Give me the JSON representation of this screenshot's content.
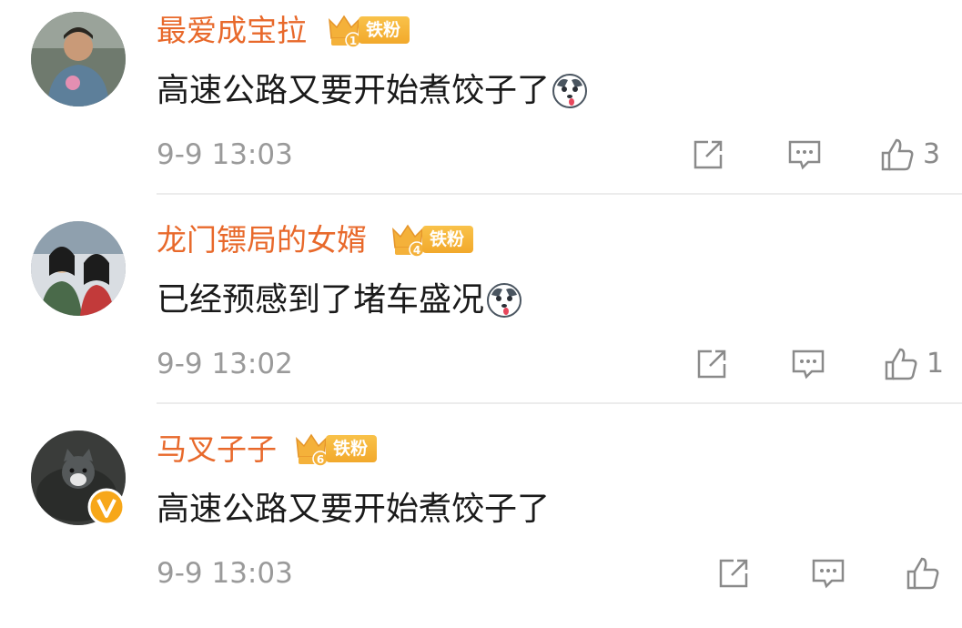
{
  "comments": [
    {
      "username": "最爱成宝拉",
      "fan_level": "1",
      "fan_label": "铁粉",
      "text": "高速公路又要开始煮饺子了",
      "has_emoji": true,
      "emoji_icon": "husky-dog-emoji-icon",
      "timestamp": "9-9 13:03",
      "like_count": "3"
    },
    {
      "username": "龙门镖局的女婿",
      "fan_level": "4",
      "fan_label": "铁粉",
      "text": "已经预感到了堵车盛况",
      "has_emoji": true,
      "emoji_icon": "husky-dog-emoji-icon",
      "timestamp": "9-9 13:02",
      "like_count": "1"
    },
    {
      "username": "马叉子子",
      "fan_level": "6",
      "fan_label": "铁粉",
      "text": "高速公路又要开始煮饺子了",
      "has_emoji": false,
      "verified": true,
      "timestamp": "9-9 13:03",
      "like_count": ""
    }
  ],
  "icons": {
    "share": "share-icon",
    "reply": "comment-icon",
    "like": "thumbs-up-icon",
    "verified": "verified-v-icon"
  },
  "colors": {
    "username": "#e8692b",
    "badge": "#f4b13a",
    "text": "#1a1a1a",
    "meta": "#9a9a9a",
    "icon": "#8a8a8a"
  }
}
